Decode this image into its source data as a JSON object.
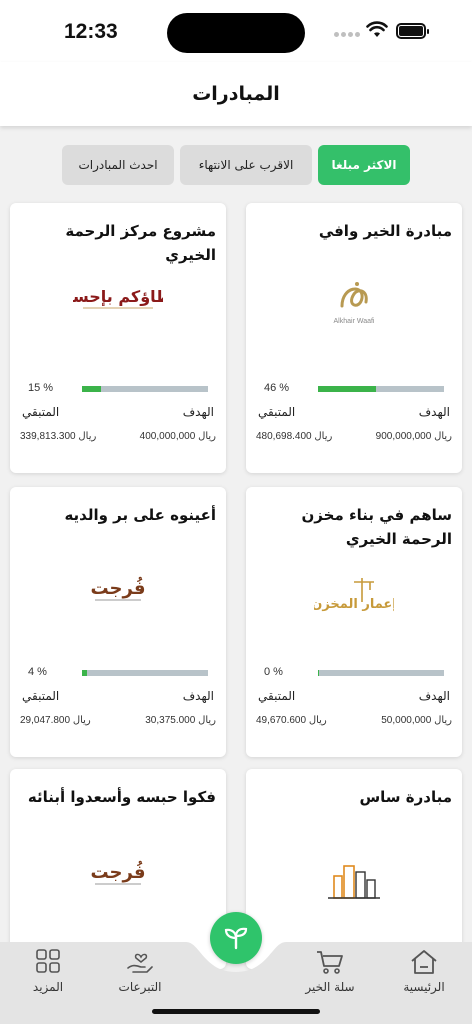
{
  "status_bar": {
    "time": "12:33"
  },
  "header": {
    "title": "المبادرات"
  },
  "filters": [
    {
      "label": "الاكثر مبلغا",
      "active": true
    },
    {
      "label": "الاقرب على الانتهاء",
      "active": false
    },
    {
      "label": "احدث المبادرات",
      "active": false
    }
  ],
  "labels": {
    "goal": "الهدف",
    "remaining": "المتبقي"
  },
  "cards": [
    {
      "title": "مبادرة الخير وافي",
      "percent_text": "46 %",
      "progress": 0.46,
      "goal": "900,000,000 ريال",
      "remaining": "480,698.400 ريال",
      "logo_text": "Alkhair Waafi",
      "logo": "alkhair-waafi-logo"
    },
    {
      "title": "مشروع مركز الرحمة الخيري",
      "percent_text": "15 %",
      "progress": 0.15,
      "goal": "400,000,000 ريال",
      "remaining": "339,813.300 ريال",
      "logo_text": "عطاؤكم بإحسان",
      "logo": "ataukum-logo"
    },
    {
      "title": "ساهم في بناء مخزن الرحمة الخيري",
      "percent_text": "0 %",
      "progress": 0.0,
      "goal": "50,000,000 ريال",
      "remaining": "49,670.600 ريال",
      "logo_text": "إعمار المخزن",
      "logo": "emar-almakhzan-logo"
    },
    {
      "title": "أعينوه على بر والديه",
      "percent_text": "4 %",
      "progress": 0.04,
      "goal": "30,375.000 ريال",
      "remaining": "29,047.800 ريال",
      "logo_text": "فُرجت",
      "logo": "furijat-logo"
    },
    {
      "title": "مبادرة ساس",
      "logo": "buildings-logo"
    },
    {
      "title": "فكوا حبسه وأسعدوا أبنائه",
      "logo_text": "فُرجت",
      "logo": "furijat-logo"
    }
  ],
  "bottom_nav": [
    {
      "label": "الرئيسية",
      "icon": "home-icon"
    },
    {
      "label": "سلة الخير",
      "icon": "cart-icon"
    },
    {
      "label": "التبرعات",
      "icon": "donation-hand-icon"
    },
    {
      "label": "المزيد",
      "icon": "grid-icon"
    }
  ],
  "colors": {
    "accent": "#34c06a",
    "progress_fill": "#3bb34a",
    "progress_track": "#b8c3c9"
  }
}
